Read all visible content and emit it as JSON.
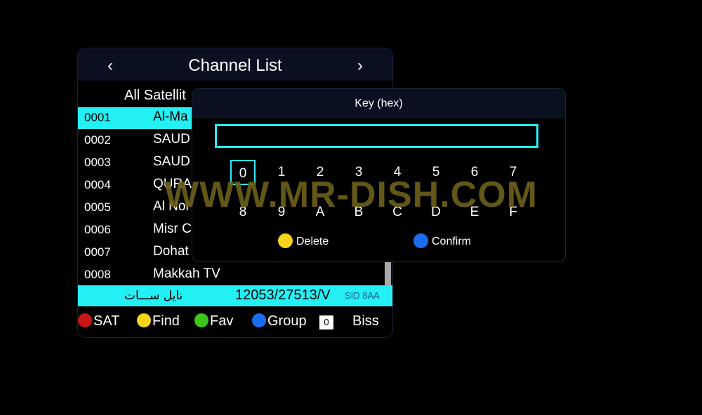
{
  "channel_list": {
    "title": "Channel List",
    "nav_left": "‹",
    "nav_right": "›",
    "satellite": "All Satellit",
    "rows": [
      {
        "num": "0001",
        "name": "Al-Ma"
      },
      {
        "num": "0002",
        "name": "SAUD"
      },
      {
        "num": "0003",
        "name": "SAUD"
      },
      {
        "num": "0004",
        "name": "QURA"
      },
      {
        "num": "0005",
        "name": "Al Nor"
      },
      {
        "num": "0006",
        "name": "Misr C"
      },
      {
        "num": "0007",
        "name": "Dohat"
      },
      {
        "num": "0008",
        "name": "Makkah TV"
      }
    ],
    "info": {
      "satellite_name": "نايل ســـات",
      "frequency": "12053/27513/V",
      "sid": "SID 8AA"
    },
    "footer": {
      "sat": "SAT",
      "find": "Find",
      "fav": "Fav",
      "group": "Group",
      "group_value": "0",
      "biss": "Biss"
    }
  },
  "key_dialog": {
    "title": "Key (hex)",
    "value": "",
    "keys": [
      "0",
      "1",
      "2",
      "3",
      "4",
      "5",
      "6",
      "7",
      "8",
      "9",
      "A",
      "B",
      "C",
      "D",
      "E",
      "F"
    ],
    "focused_key": "0",
    "delete_label": "Delete",
    "confirm_label": "Confirm"
  },
  "watermark": "WWW.MR-DISH.COM",
  "colors": {
    "highlight": "#23f0f4",
    "red": "#c81616",
    "yellow": "#f6d41c",
    "green": "#3ec51c",
    "blue": "#1a6cf0"
  }
}
